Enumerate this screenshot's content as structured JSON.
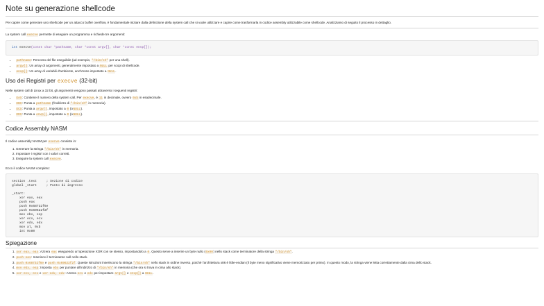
{
  "title": "Note su generazione shellcode",
  "intro": "Per capire come generare uno shellcode per un attacco buffer overflow, è fondamentale iniziare dalla definizione della system call che si vuole utilizzare e capire come trasformarla in codice assembly utilizzabile come shellcode. Analizziamo di seguito il processo in dettaglio.",
  "syscall_intro": {
    "before": "La system call",
    "code": "execve",
    "after": "permette di eseguire un programma e richiede tre argomenti:"
  },
  "c_code": {
    "ret_type": "int",
    "func": "execve",
    "args": "(const char *pathname, char *const argv[], char *const envp[]);"
  },
  "args_list": [
    {
      "code": "pathname",
      "text": ": Percorso del file eseguibile (ad esempio,",
      "code2": "\"/bin/sh\"",
      "tail": "per una shell)."
    },
    {
      "code": "argv[]",
      "text": ": Un array di argomenti, generalmente impostato a",
      "code2": "NULL",
      "tail": "per scopi di shellcode."
    },
    {
      "code": "envp[]",
      "text": ": Un array di variabili d'ambiente, anch'esso impostato a",
      "code2": "NULL",
      "tail": "."
    }
  ],
  "registers_section": {
    "heading_before": "Uso dei Registri per",
    "heading_code": "execve",
    "heading_after": "(32-bit)",
    "intro": "Nelle system call di Linux a 32 bit, gli argomenti vengono passati attraverso i seguenti registri:"
  },
  "reg_list": {
    "eax": {
      "code": "EAX",
      "t1": ": Contiene il numero della system call. Per",
      "c1": "execve",
      "t2": ", è",
      "c2": "11",
      "t3": "in decimale, ovvero",
      "c3": "0xb",
      "t4": "in esadecimale."
    },
    "ebx": {
      "code": "EBX",
      "t1": ": Punta a",
      "c1": "pathname",
      "t2": "(l'indirizzo di",
      "c2": "\"/bin/sh\"",
      "t3": "in memoria)."
    },
    "ecx": {
      "code": "ECX",
      "t1": ": Punta a",
      "c1": "argv[]",
      "t2": ", impostato a",
      "c2": "0",
      "t3": "(o",
      "c3": "NULL",
      "t4": ")."
    },
    "edx": {
      "code": "EDX",
      "t1": ": Punta a",
      "c1": "envp[]",
      "t2": ", impostato a",
      "c2": "0",
      "t3": "(o",
      "c3": "NULL",
      "t4": ")."
    }
  },
  "nasm_section": {
    "heading": "Codice Assembly NASM",
    "intro_before": "Il codice assembly NASM per",
    "intro_code": "execve",
    "intro_after": "consiste in:"
  },
  "steps_list": [
    {
      "text": "Generare la stringa",
      "code": "\"/bin/sh\"",
      "tail": "in memoria."
    },
    {
      "text": "Impostare i registri con i valori corretti.",
      "code": "",
      "tail": ""
    },
    {
      "text": "Eseguire la system call",
      "code": "execve",
      "tail": "."
    }
  ],
  "nasm_intro": "Ecco il codice NASM completo:",
  "nasm_code": "section .text     ; Sezione di codice\nglobal _start     ; Punto di ingresso\n\n_start:\n    xor eax, eax\n    push eax\n    push 0x68732f6e\n    push 0x69622f2f\n    mov ebx, esp\n    xor ecx, ecx\n    xor edx, edx\n    mov al, 0xb\n    int 0x80",
  "explain_heading": "Spiegazione",
  "explain_list": {
    "e1": {
      "c1": "xor eax, eax",
      "t1": ": Azzera",
      "c2": "eax",
      "t2": "eseguendo un'operazione XOR con se stesso, impostandolo a",
      "c3": "0",
      "t3": ". Questo serve a inserire un byte nullo (",
      "c4": "0x00",
      "t4": ") nello stack come terminatore della stringa",
      "c5": "\"/bin/sh\"",
      "t5": "."
    },
    "e2": {
      "c1": "push eax",
      "t1": ": Inserisce il terminatore null nello stack."
    },
    "e3": {
      "c1": "push 0x68732f6e",
      "t1": "e",
      "c2": "push 0x69622f2f",
      "t2": ": Queste istruzioni inseriscono la stringa",
      "c3": "\"/bin/sh\"",
      "t3": "nello stack in ordine inverso, poiché l'architettura x86 è little-endian (il byte meno significativo viene memorizzato per primo). In questo modo, la stringa viene letta correttamente dalla cima dello stack."
    },
    "e4": {
      "c1": "mov ebx, esp",
      "t1": ": Imposta",
      "c2": "ebx",
      "t2": "per puntare all'indirizzo di",
      "c3": "\"/bin/sh\"",
      "t3": "in memoria (che ora si trova in cima allo stack)."
    },
    "e5": {
      "c1": "xor ecx, ecx",
      "t1": "e",
      "c2": "xor edx, edx",
      "t2": ": Azzera",
      "c3": "ecx",
      "t3": "e",
      "c4": "edx",
      "t4": "per impostare",
      "c5": "argv[]",
      "t5": "e",
      "c6": "envp[]",
      "t6": "a",
      "c7": "NULL",
      "t7": "."
    }
  },
  "colors": {
    "inline_code": "#d0922e",
    "code_bg": "#f6f6f6",
    "keyword": "#3f6fb5",
    "type": "#8e59b0"
  }
}
